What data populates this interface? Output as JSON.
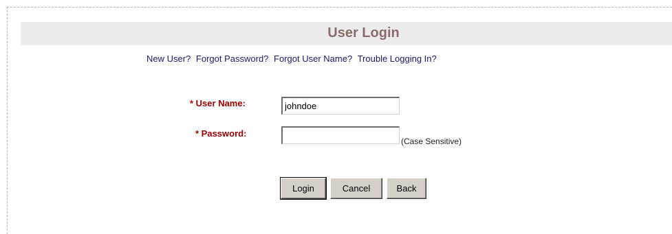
{
  "page": {
    "title": "User Login"
  },
  "links": {
    "new_user": "New User?",
    "forgot_password": "Forgot Password?",
    "forgot_user_name": "Forgot User Name?",
    "trouble": "Trouble Logging In?"
  },
  "form": {
    "username_label": "* User Name:",
    "username_value": "johndoe",
    "password_label": "* Password:",
    "password_value": "",
    "password_hint": "(Case Sensitive)"
  },
  "buttons": {
    "login": "Login",
    "cancel": "Cancel",
    "back": "Back"
  },
  "colors": {
    "title": "#8c6b6b",
    "link": "#1a1a6e",
    "required_label": "#a00000",
    "title_bar_bg": "#ececec"
  }
}
